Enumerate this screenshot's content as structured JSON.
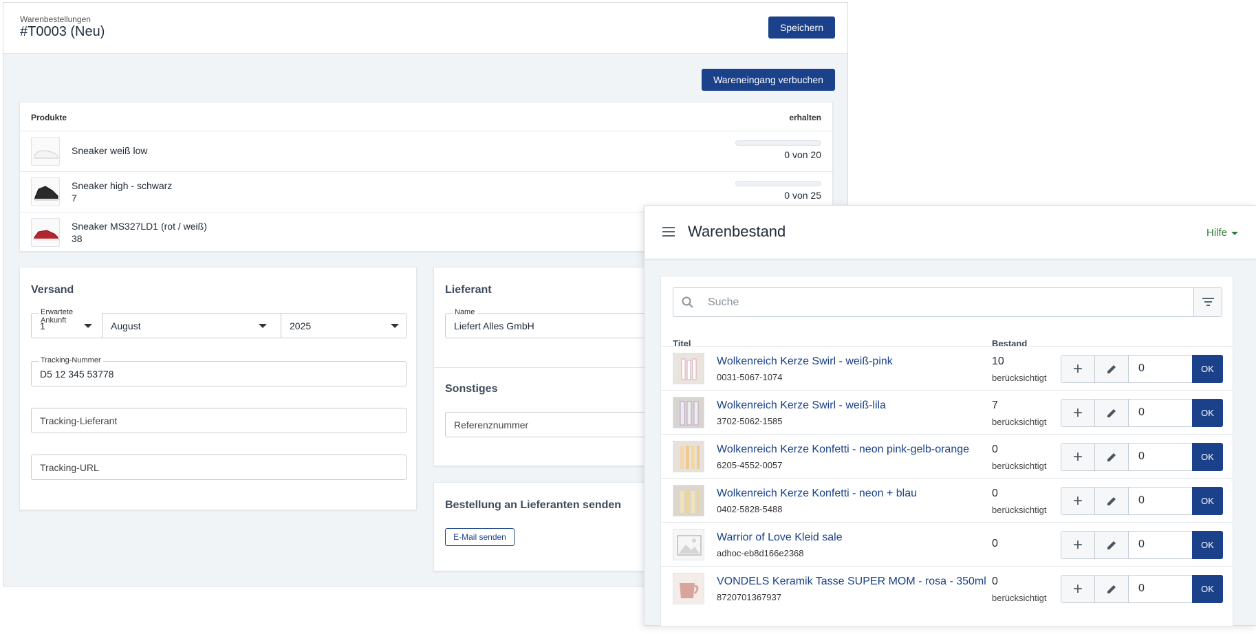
{
  "order": {
    "subtitle": "Warenbestellungen",
    "title": "#T0003 (Neu)",
    "save_label": "Speichern",
    "receive_label": "Wareneingang verbuchen",
    "products_header": "Produkte",
    "received_header": "erhalten",
    "products": [
      {
        "name": "Sneaker weiß low",
        "sub": "",
        "count": "0 von 20",
        "received_fraction": 0
      },
      {
        "name": "Sneaker high - schwarz",
        "sub": "7",
        "count": "0 von 25",
        "received_fraction": 0
      },
      {
        "name": "Sneaker MS327LD1 (rot / weiß)",
        "sub": "38",
        "count": "",
        "received_fraction": 0
      }
    ],
    "shipping": {
      "title": "Versand",
      "arrival_label": "Erwartete Ankunft",
      "day": "1",
      "month": "August",
      "year": "2025",
      "tracking_number_label": "Tracking-Nummer",
      "tracking_number": "D5 12 345 53778",
      "tracking_carrier_placeholder": "Tracking-Lieferant",
      "tracking_url_placeholder": "Tracking-URL"
    },
    "supplier": {
      "title": "Lieferant",
      "name_label": "Name",
      "name": "Liefert Alles GmbH"
    },
    "misc": {
      "title": "Sonstiges",
      "reference_placeholder": "Referenznummer"
    },
    "send": {
      "title": "Bestellung an Lieferanten senden",
      "email_label": "E-Mail senden"
    }
  },
  "inventory": {
    "title": "Warenbestand",
    "help_label": "Hilfe",
    "search_placeholder": "Suche",
    "col_title": "Titel",
    "col_stock": "Bestand",
    "ok_label": "OK",
    "items": [
      {
        "title": "Wolkenreich Kerze Swirl - weiß-pink",
        "sku": "0031-5067-1074",
        "stock": "10",
        "note": "berücksichtigt",
        "qty": "0"
      },
      {
        "title": "Wolkenreich Kerze Swirl - weiß-lila",
        "sku": "3702-5062-1585",
        "stock": "7",
        "note": "berücksichtigt",
        "qty": "0"
      },
      {
        "title": "Wolkenreich Kerze Konfetti - neon pink-gelb-orange",
        "sku": "6205-4552-0057",
        "stock": "0",
        "note": "berücksichtigt",
        "qty": "0"
      },
      {
        "title": "Wolkenreich Kerze Konfetti - neon + blau",
        "sku": "0402-5828-5488",
        "stock": "0",
        "note": "berücksichtigt",
        "qty": "0"
      },
      {
        "title": "Warrior of Love Kleid sale",
        "sku": "adhoc-eb8d166e2368",
        "stock": "0",
        "note": "",
        "qty": "0"
      },
      {
        "title": "VONDELS Keramik Tasse SUPER MOM - rosa - 350ml",
        "sku": "8720701367937",
        "stock": "0",
        "note": "berücksichtigt",
        "qty": "0"
      }
    ]
  },
  "colors": {
    "primary": "#1a4189",
    "link": "#1a4189",
    "help": "#2e7d32"
  }
}
